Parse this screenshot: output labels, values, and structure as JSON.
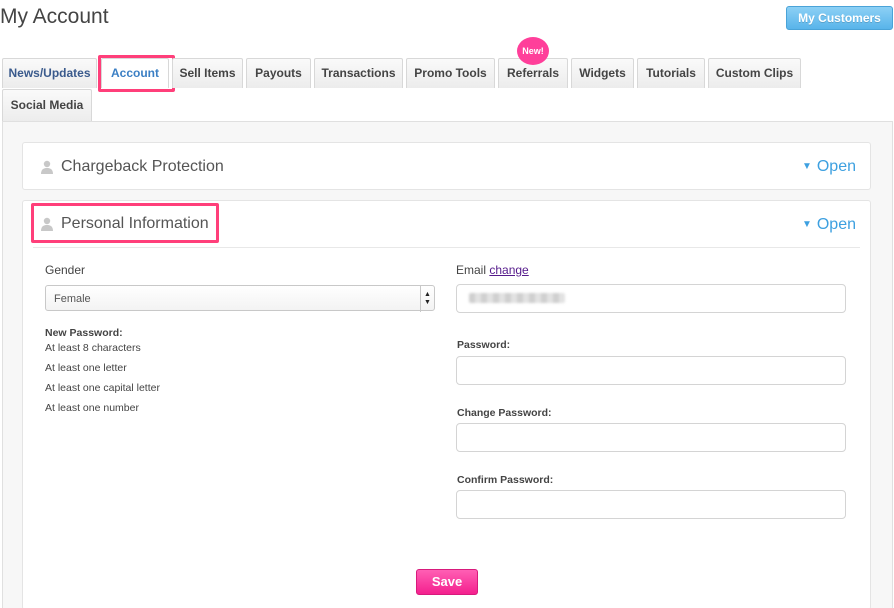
{
  "header": {
    "title": "My Account",
    "my_customers_label": "My Customers"
  },
  "tabs": [
    {
      "label": "News/Updates"
    },
    {
      "label": "Account",
      "active": true
    },
    {
      "label": "Sell Items"
    },
    {
      "label": "Payouts"
    },
    {
      "label": "Transactions"
    },
    {
      "label": "Promo Tools"
    },
    {
      "label": "Referrals",
      "badge": "New!"
    },
    {
      "label": "Widgets"
    },
    {
      "label": "Tutorials"
    },
    {
      "label": "Custom Clips"
    },
    {
      "label": "Social Media"
    }
  ],
  "sections": {
    "chargeback": {
      "title": "Chargeback Protection",
      "open_label": "Open"
    },
    "personal": {
      "title": "Personal Information",
      "open_label": "Open"
    }
  },
  "form": {
    "gender_label": "Gender",
    "gender_value": "Female",
    "new_password_label": "New Password:",
    "requirements": [
      "At least 8 characters",
      "At least one letter",
      "At least one capital letter",
      "At least one number"
    ],
    "email_label": "Email",
    "email_change_link": "change",
    "password_label": "Password:",
    "change_password_label": "Change Password:",
    "confirm_password_label": "Confirm Password:",
    "save_label": "Save"
  },
  "colors": {
    "accent": "#3da0e0",
    "highlight": "#ff3f7a",
    "save_button": "#f4208e",
    "badge": "#ff3f9a"
  }
}
